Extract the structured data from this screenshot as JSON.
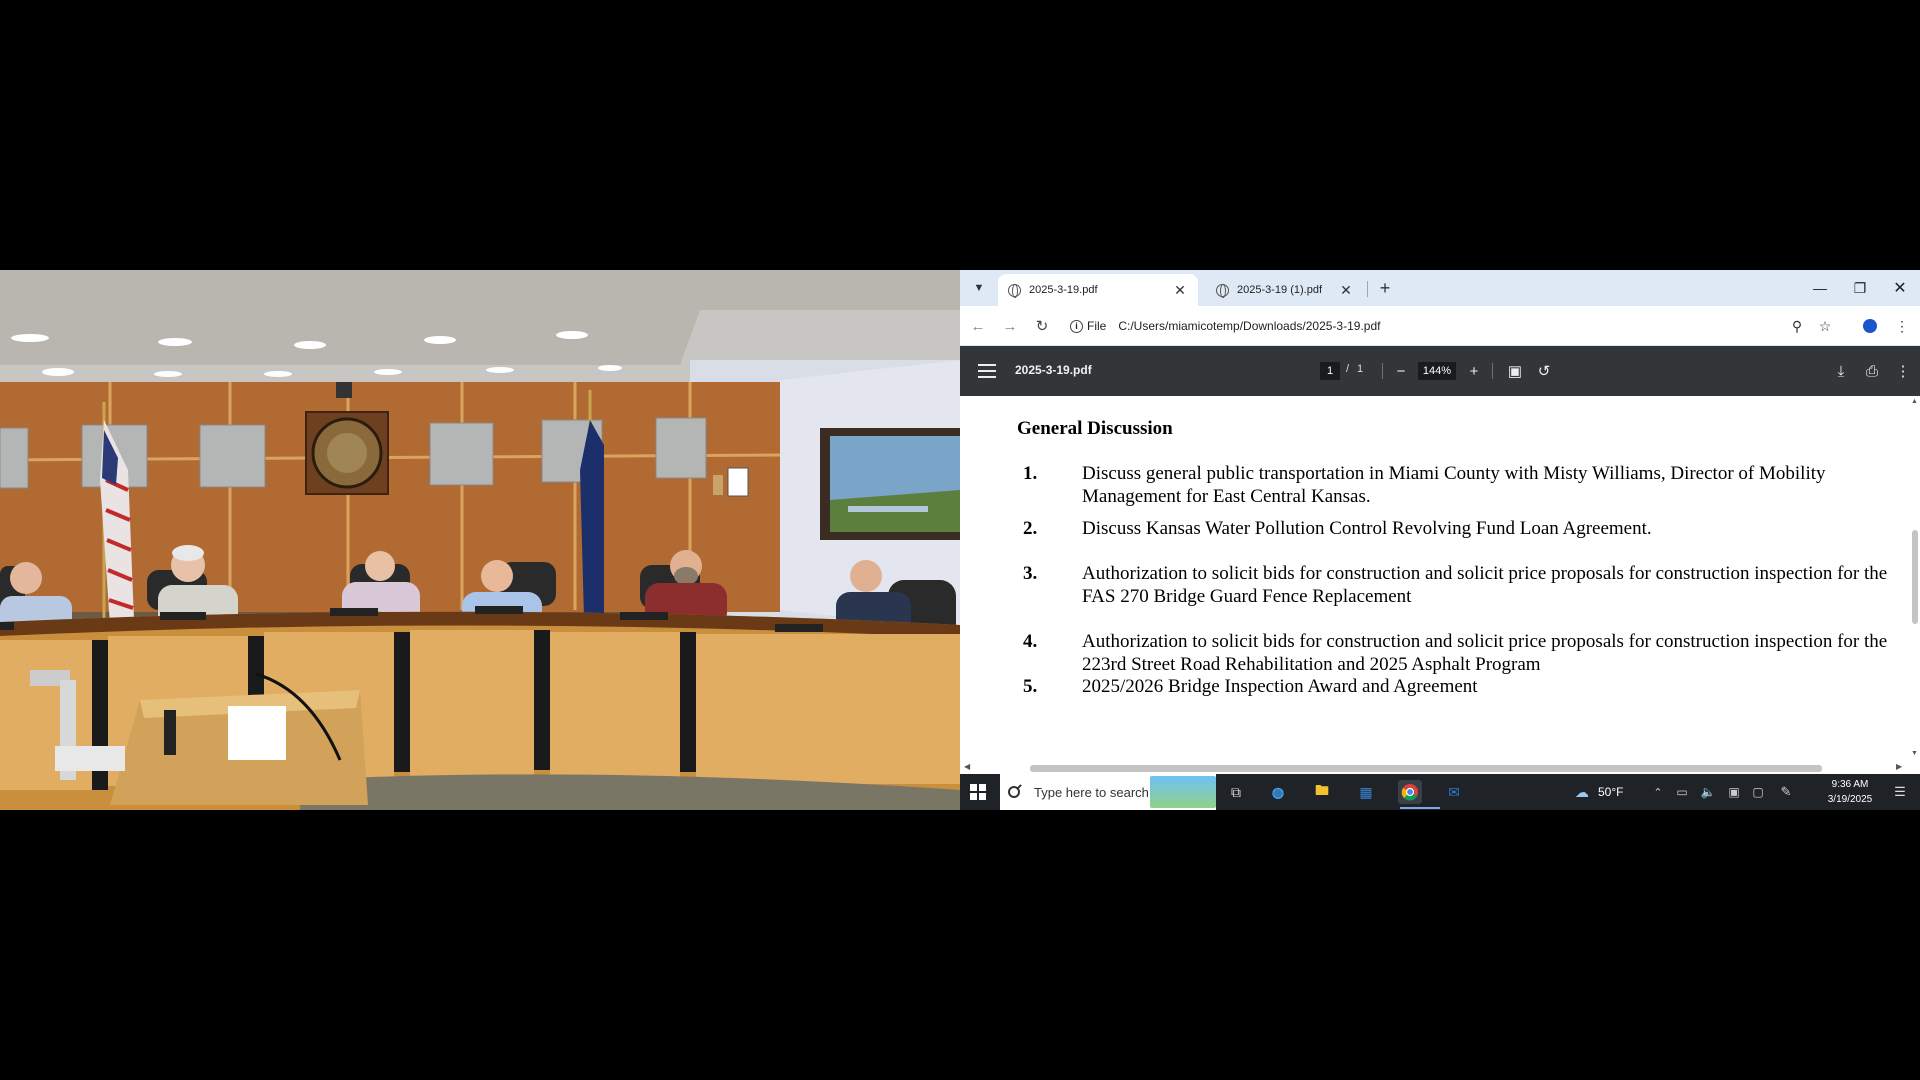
{
  "browser": {
    "tabs": [
      {
        "label": "2025-3-19.pdf",
        "active": true
      },
      {
        "label": "2025-3-19 (1).pdf",
        "active": false
      }
    ],
    "address": {
      "scheme": "File",
      "url": "C:/Users/miamicotemp/Downloads/2025-3-19.pdf"
    }
  },
  "pdf_toolbar": {
    "title": "2025-3-19.pdf",
    "page_current": "1",
    "page_separator": "/",
    "page_total": "1",
    "zoom": "144%"
  },
  "document": {
    "heading": "General Discussion",
    "items": [
      {
        "num": "1.",
        "text": "Discuss general public transportation in Miami County with Misty Williams, Director of Mobility Management for East Central Kansas."
      },
      {
        "num": "2.",
        "text": "Discuss Kansas Water Pollution Control Revolving Fund Loan Agreement."
      },
      {
        "num": "3.",
        "text": "Authorization to solicit bids for construction and solicit price proposals for construction inspection for the FAS 270 Bridge Guard Fence Replacement"
      },
      {
        "num": "4.",
        "text": "Authorization to solicit bids for construction and solicit price proposals for construction inspection for the 223rd Street Road Rehabilitation and 2025 Asphalt Program"
      },
      {
        "num": "5.",
        "text": "2025/2026 Bridge Inspection Award and Agreement"
      }
    ]
  },
  "taskbar": {
    "search_placeholder": "Type here to search",
    "weather": "50°F",
    "time": "9:36 AM",
    "date": "3/19/2025"
  },
  "colors": {
    "tabstrip": "#dfe8f5",
    "pdf_toolbar": "#323639",
    "taskbar": "#1f2227",
    "profile": "#1a56c9"
  }
}
